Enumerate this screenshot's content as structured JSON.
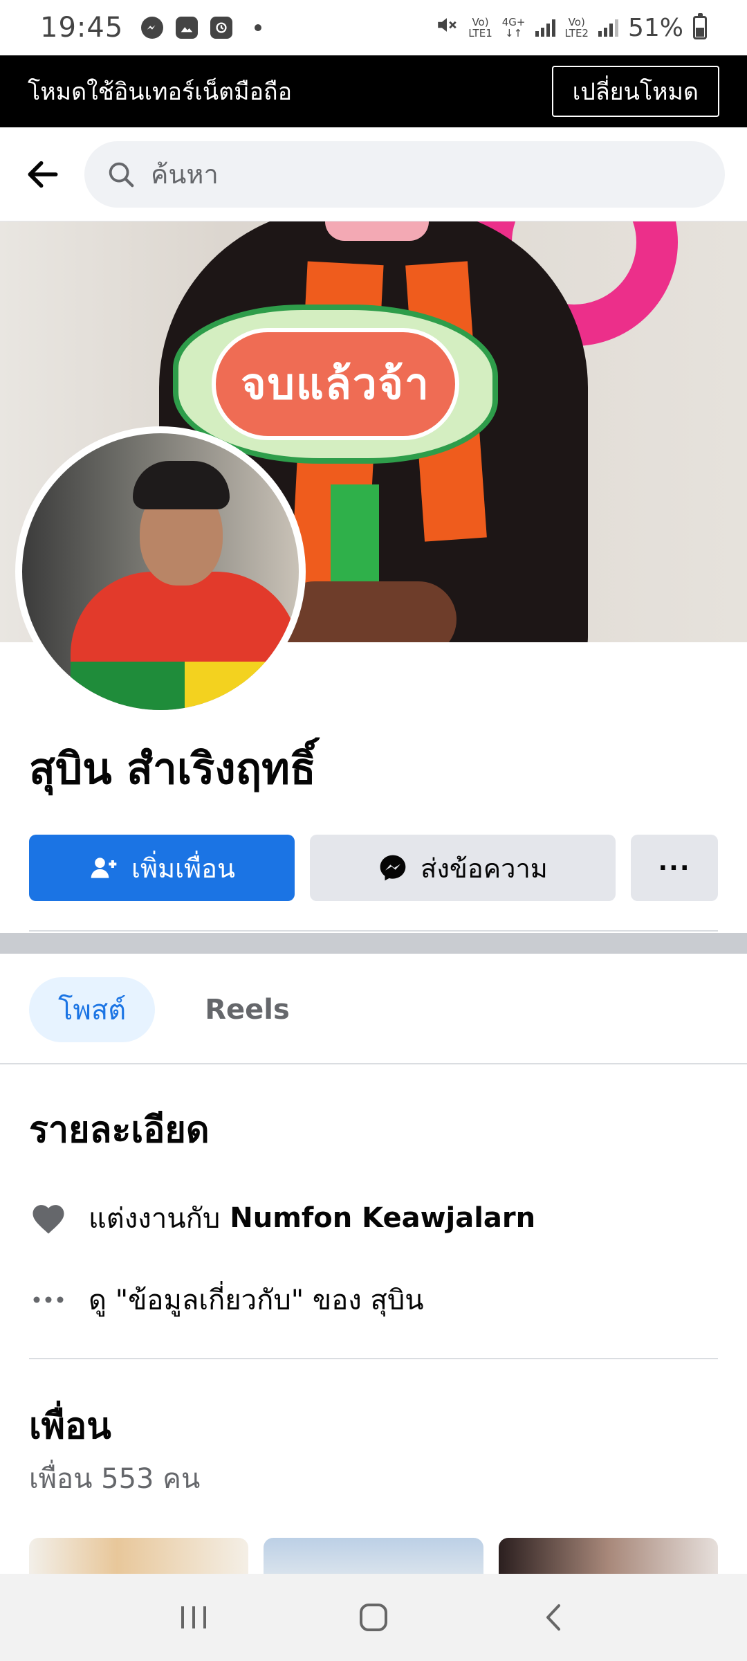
{
  "status_bar": {
    "time": "19:45",
    "net1_top": "Vo)",
    "net1_bottom": "LTE1",
    "net_type": "4G+",
    "net2_top": "Vo)",
    "net2_bottom": "LTE2",
    "battery": "51%"
  },
  "mode_banner": {
    "text": "โหมดใช้อินเทอร์เน็ตมือถือ",
    "button": "เปลี่ยนโหมด"
  },
  "search": {
    "placeholder": "ค้นหา"
  },
  "cover": {
    "sign_text": "จบแล้วจ้า"
  },
  "profile": {
    "name": "สุบิน สำเริงฤทธิ์",
    "add_friend_label": "เพิ่มเพื่อน",
    "message_label": "ส่งข้อความ",
    "more_label": "···"
  },
  "tabs": [
    {
      "label": "โพสต์",
      "active": true
    },
    {
      "label": "Reels",
      "active": false
    }
  ],
  "details": {
    "title": "รายละเอียด",
    "relationship_prefix": "แต่งงานกับ",
    "relationship_name": "Numfon Keawjalarn",
    "about_link": "ดู \"ข้อมูลเกี่ยวกับ\" ของ สุบิน"
  },
  "friends": {
    "title": "เพื่อน",
    "count_text": "เพื่อน 553 คน"
  },
  "colors": {
    "primary": "#1b74e4",
    "secondary_button": "#e4e6eb",
    "banner": "#000000"
  }
}
